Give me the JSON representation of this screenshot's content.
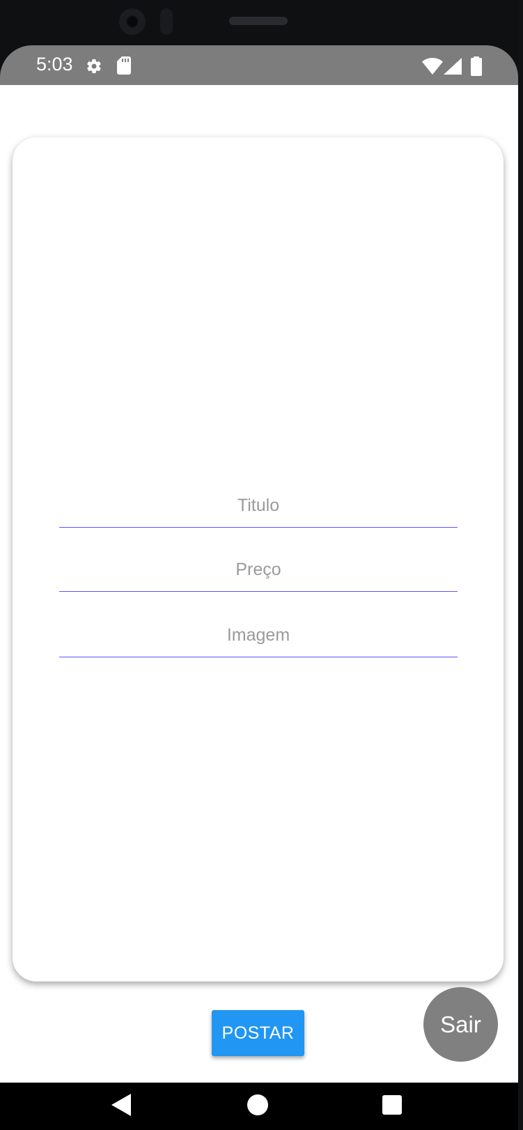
{
  "status_bar": {
    "time": "5:03",
    "icons": [
      "gear-icon",
      "sd-card-icon",
      "wifi-icon",
      "signal-icon",
      "battery-icon"
    ]
  },
  "form": {
    "titulo_placeholder": "Titulo",
    "preco_placeholder": "Preço",
    "imagem_placeholder": "Imagem"
  },
  "actions": {
    "post_label": "POSTAR",
    "exit_label": "Sair"
  },
  "nav_bar": {
    "icons": [
      "back-icon",
      "home-icon",
      "recents-icon"
    ]
  },
  "colors": {
    "status_bar": "#7d7d7d",
    "field_underline": "#5b55ff",
    "post_button": "#2196f3",
    "exit_button": "#808080"
  }
}
